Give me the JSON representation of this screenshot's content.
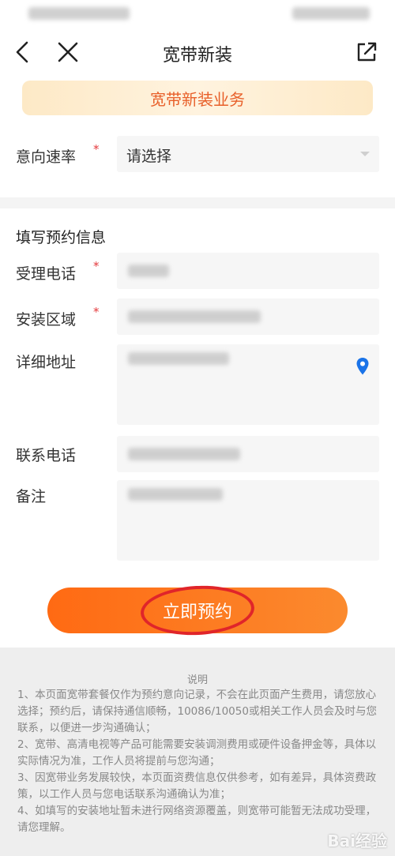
{
  "header": {
    "title": "宽带新装"
  },
  "banner": {
    "text": "宽带新装业务"
  },
  "rate": {
    "label": "意向速率",
    "required_mark": "*",
    "select_value": "请选择"
  },
  "form": {
    "section_title": "填写预约信息",
    "fields": [
      {
        "label": "受理电话",
        "required_mark": "*"
      },
      {
        "label": "安装区域",
        "required_mark": "*"
      },
      {
        "label": "详细地址"
      },
      {
        "label": "联系电话"
      },
      {
        "label": "备注"
      }
    ]
  },
  "submit": {
    "label": "立即预约"
  },
  "notes": {
    "title": "说明",
    "lines": [
      "1、本页面宽带套餐仅作为预约意向记录，不会在此页面产生费用，请您放心选择；预约后，请保持通信顺畅，10086/10050或相关工作人员会及时与您联系，以便进一步沟通确认；",
      "2、宽带、高清电视等产品可能需要安装调测费用或硬件设备押金等，具体以实际情况为准，工作人员将提前与您沟通；",
      "3、因宽带业务发展较快，本页面资费信息仅供参考，如有差异，具体资费政策，以工作人员与您电话联系沟通确认为准；",
      "4、如填写的安装地址暂未进行网络资源覆盖，则宽带可能暂无法成功受理，请您理解。"
    ]
  },
  "watermark": "Bai经验",
  "colors": {
    "accent": "#ff6a13",
    "banner_text": "#e8602a",
    "required": "#e4393c",
    "location_pin": "#1a73e8"
  }
}
